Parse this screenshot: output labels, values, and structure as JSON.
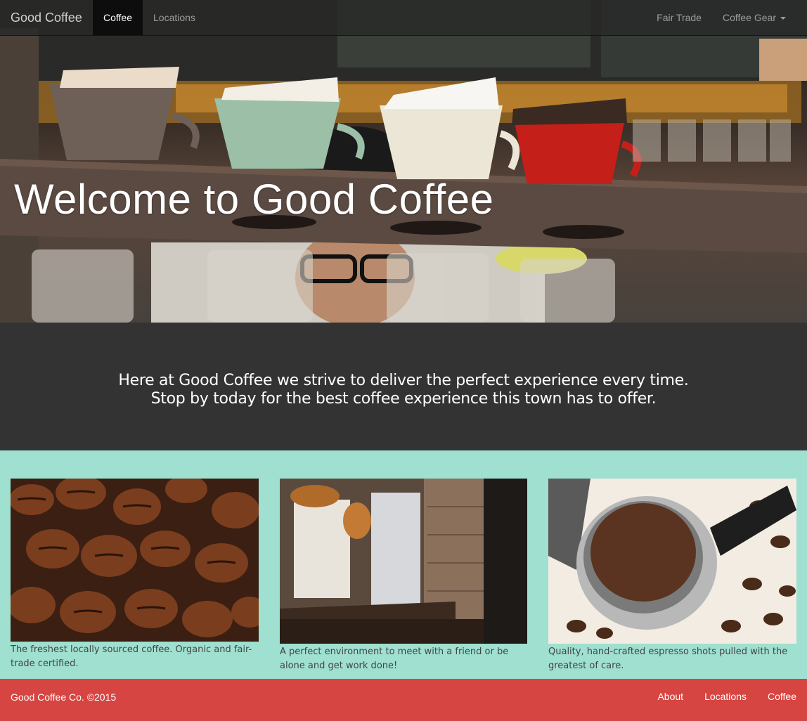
{
  "navbar": {
    "brand": "Good Coffee",
    "left_links": [
      "Coffee",
      "Locations"
    ],
    "right_links": [
      "Fair Trade",
      "Coffee Gear"
    ]
  },
  "hero": {
    "title": "Welcome to Good Coffee"
  },
  "intro": {
    "line1": "Here at Good Coffee we strive to deliver the perfect experience every time.",
    "line2": "Stop by today for the best coffee experience this town has to offer."
  },
  "features": [
    {
      "caption": "The freshest locally sourced coffee. Organic and fair-trade certified."
    },
    {
      "caption": "A perfect environment to meet with a friend or be alone and get work done!"
    },
    {
      "caption": "Quality, hand-crafted espresso shots pulled with the greatest of care."
    }
  ],
  "footer": {
    "copyright": "Good Coffee Co. ©2015",
    "links": [
      "About",
      "Locations",
      "Coffee"
    ]
  },
  "colors": {
    "navbar_bg": "#282828",
    "intro_bg": "#333333",
    "features_bg": "#9fe0d0",
    "footer_bg": "#d64541"
  }
}
